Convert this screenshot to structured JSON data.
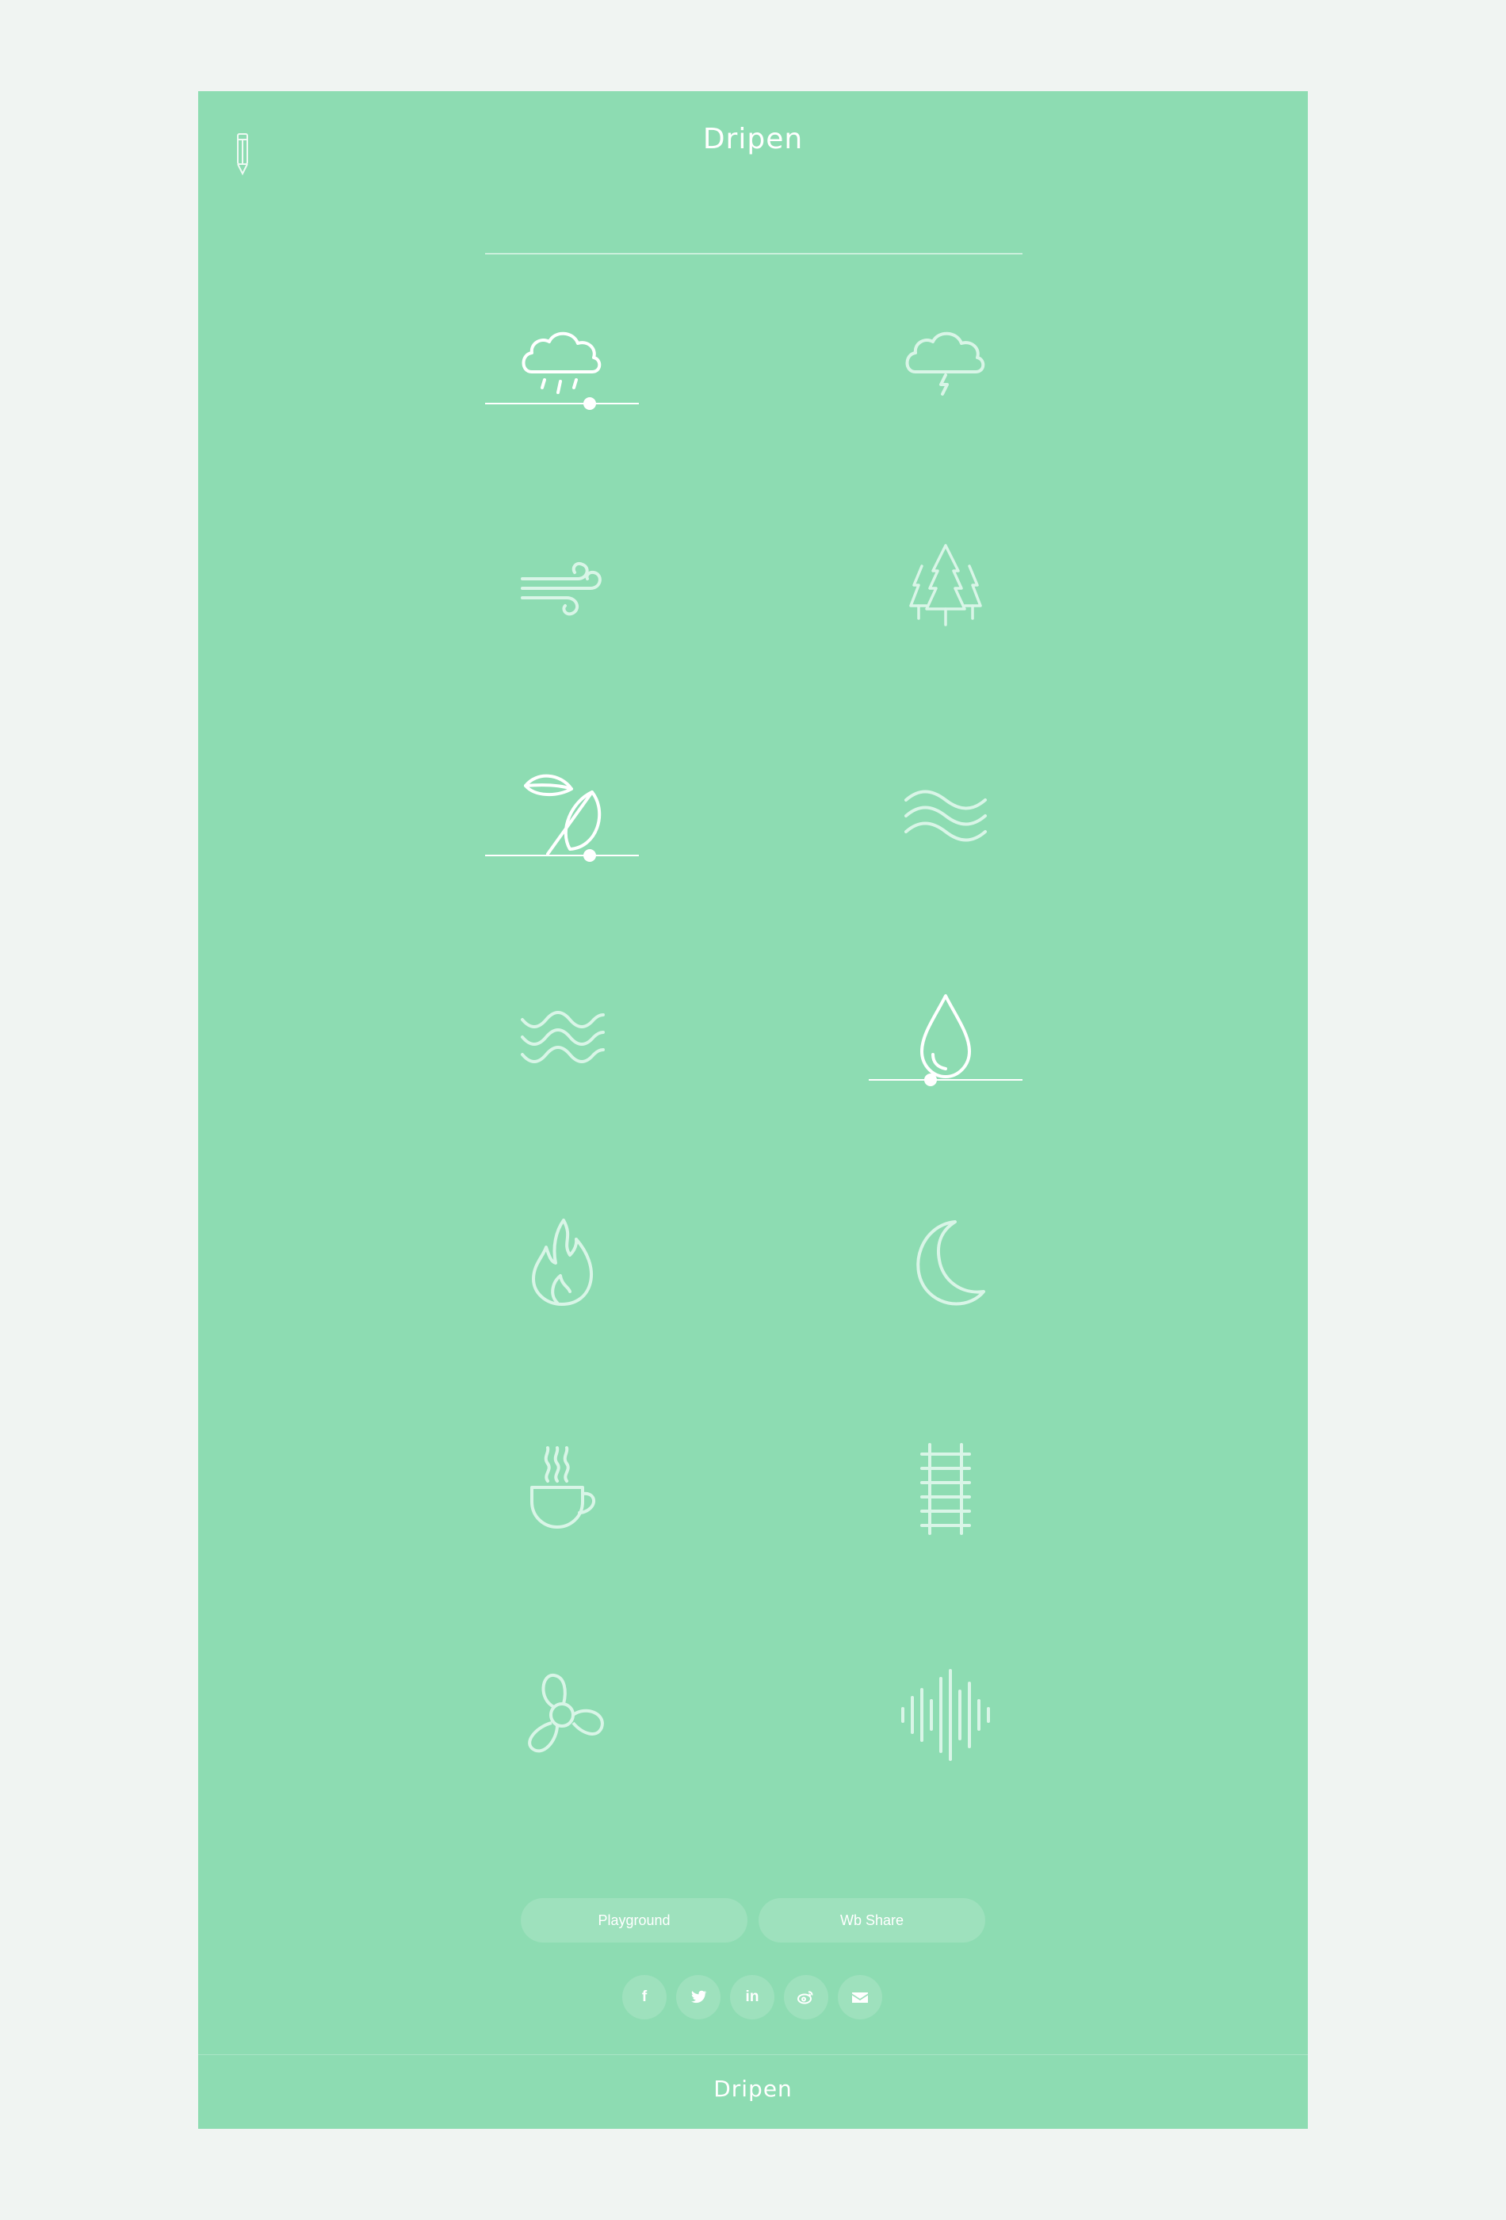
{
  "header": {
    "title": "Dripen",
    "edit_icon": "pencil-icon"
  },
  "theme": {
    "background": "#f0f4f2",
    "card": "#8ddcb2",
    "active": "#ffffff",
    "inactive": "#d9f5e7"
  },
  "sounds": [
    {
      "icon": "rain-icon",
      "active": true,
      "volume": 0.68
    },
    {
      "icon": "thunderstorm-icon",
      "active": false
    },
    {
      "icon": "wind-icon",
      "active": false
    },
    {
      "icon": "forest-icon",
      "active": false
    },
    {
      "icon": "leaves-icon",
      "active": true,
      "volume": 0.68
    },
    {
      "icon": "stream-icon",
      "active": false
    },
    {
      "icon": "waves-icon",
      "active": false
    },
    {
      "icon": "water-drop-icon",
      "active": true,
      "volume": 0.4
    },
    {
      "icon": "fire-icon",
      "active": false
    },
    {
      "icon": "night-icon",
      "active": false
    },
    {
      "icon": "coffee-icon",
      "active": false
    },
    {
      "icon": "train-tracks-icon",
      "active": false
    },
    {
      "icon": "fan-icon",
      "active": false
    },
    {
      "icon": "white-noise-icon",
      "active": false
    }
  ],
  "buttons": {
    "playground": "Playground",
    "wb_share": "Wb Share"
  },
  "social": [
    {
      "icon": "facebook-icon",
      "glyph": "f"
    },
    {
      "icon": "twitter-icon",
      "glyph": ""
    },
    {
      "icon": "linkedin-icon",
      "glyph": "in"
    },
    {
      "icon": "weibo-icon",
      "glyph": ""
    },
    {
      "icon": "email-icon",
      "glyph": ""
    }
  ],
  "footer": {
    "brand": "Dripen"
  }
}
